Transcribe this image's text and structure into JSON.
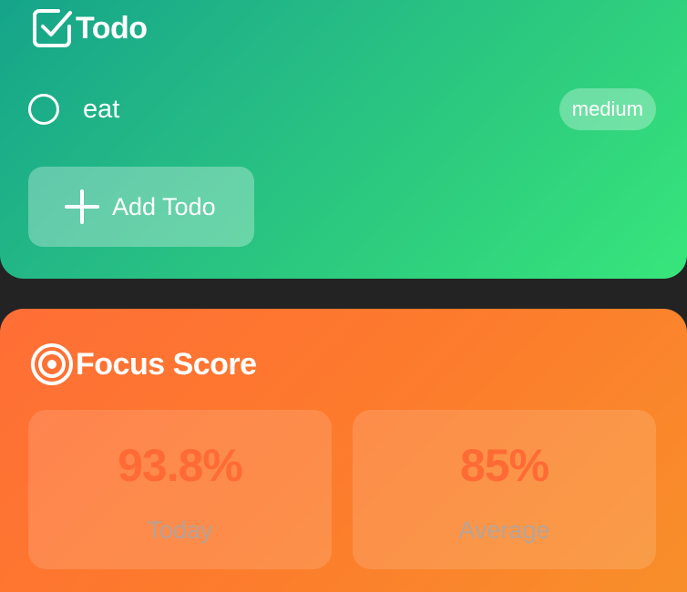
{
  "todo_card": {
    "title": "Todo",
    "title_icon": "checkbox-icon",
    "items": [
      {
        "text": "eat",
        "priority": "medium",
        "completed": false
      }
    ],
    "add_button_label": "Add Todo",
    "add_button_icon": "plus-icon",
    "gradient": [
      "#14a28a",
      "#38e67b"
    ]
  },
  "focus_card": {
    "title": "Focus Score",
    "title_icon": "target-icon",
    "stats": [
      {
        "value": "93.8%",
        "label": "Today"
      },
      {
        "value": "85%",
        "label": "Average"
      }
    ],
    "value_color": "#ff6a35",
    "gradient": [
      "#ff6e36",
      "#f8902a"
    ]
  }
}
